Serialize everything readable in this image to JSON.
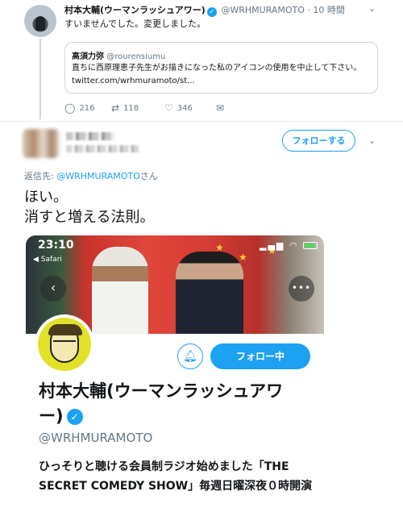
{
  "reply_tweet": {
    "name": "村本大輔(ウーマンラッシュアワー)",
    "handle": "@WRHMURAMOTO",
    "time": "· 10 時間",
    "text": "すいませんでした。変更しました。",
    "quote": {
      "name": "高須力弥",
      "handle": "@rourensiumu",
      "text": "直ちに西原理恵子先生がお描きになった私のアイコンの使用を中止して下さい。 twitter.com/wrhmuramoto/st..."
    },
    "actions": {
      "replies": "216",
      "retweets": "118",
      "likes": "346"
    }
  },
  "main_tweet": {
    "follow_label": "フォローする",
    "reply_prefix": "返信先: ",
    "reply_mention": "@WRHMURAMOTO",
    "reply_suffix": "さん",
    "text_line1": "ほい。",
    "text_line2": "消すと増える法則。"
  },
  "screenshot": {
    "status_time": "23:10",
    "status_carrier": "◀ Safari",
    "following_label": "フォロー中",
    "profile_name": "村本大輔(ウーマンラッシュアワー)",
    "profile_handle": "@WRHMURAMOTO",
    "bio": "ひっそりと聴ける会員制ラジオ始めました「THE SECRET COMEDY SHOW」毎週日曜深夜０時開演"
  },
  "colors": {
    "accent": "#1da1f2",
    "muted": "#657786",
    "border": "#ccd6dd"
  }
}
